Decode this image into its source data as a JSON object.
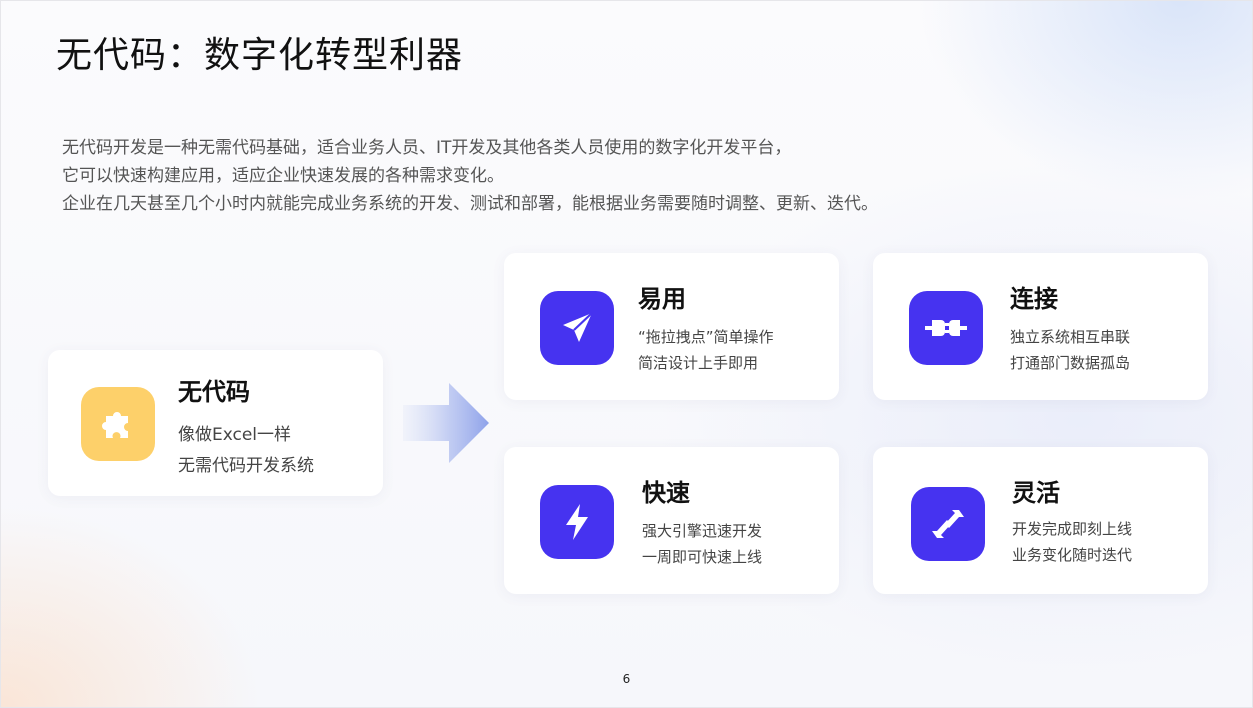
{
  "title": "无代码：数字化转型利器",
  "description": [
    "无代码开发是一种无需代码基础，适合业务人员、IT开发及其他各类人员使用的数字化开发平台，",
    "它可以快速构建应用，适应企业快速发展的各种需求变化。",
    "企业在几天甚至几个小时内就能完成业务系统的开发、测试和部署，能根据业务需要随时调整、更新、迭代。"
  ],
  "main_card": {
    "title": "无代码",
    "lines": [
      "像做Excel一样",
      "无需代码开发系统"
    ],
    "icon": "puzzle-icon",
    "icon_bg": "#fdd06a"
  },
  "features": [
    {
      "title": "易用",
      "lines": [
        "“拖拉拽点”简单操作",
        "简洁设计上手即用"
      ],
      "icon": "paper-plane-icon"
    },
    {
      "title": "连接",
      "lines": [
        "独立系统相互串联",
        "打通部门数据孤岛"
      ],
      "icon": "plug-icon"
    },
    {
      "title": "快速",
      "lines": [
        "强大引擎迅速开发",
        "一周即可快速上线"
      ],
      "icon": "lightning-icon"
    },
    {
      "title": "灵活",
      "lines": [
        "开发完成即刻上线",
        "业务变化随时迭代"
      ],
      "icon": "swap-arrows-icon"
    }
  ],
  "colors": {
    "accent": "#4633f0",
    "main_icon": "#fdd06a"
  },
  "page_number": "6"
}
